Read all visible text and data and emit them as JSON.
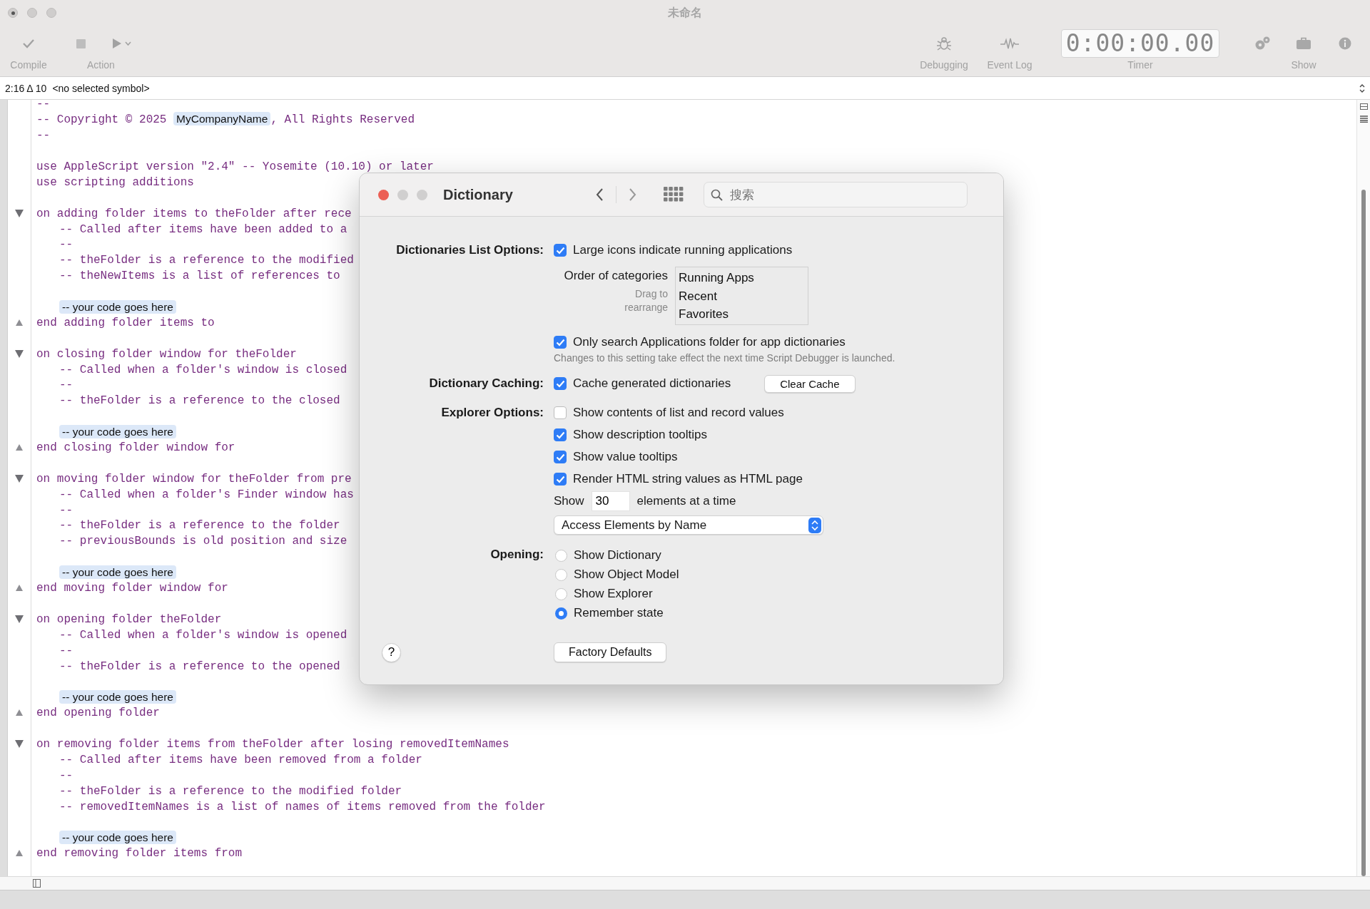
{
  "window": {
    "title": "未命名"
  },
  "toolbar": {
    "left": [
      {
        "kind": "compile",
        "label": "Compile"
      },
      {
        "kind": "action",
        "label": "Action"
      }
    ],
    "right": [
      {
        "kind": "debugging",
        "label": "Debugging"
      },
      {
        "kind": "event_log",
        "label": "Event Log"
      },
      {
        "kind": "timer",
        "label": "Timer",
        "display": "0:00:00.00"
      },
      {
        "kind": "gears"
      },
      {
        "kind": "show",
        "label": "Show"
      },
      {
        "kind": "info"
      }
    ]
  },
  "symbol_bar": {
    "position": "2:16 Δ 10",
    "symbol": "<no selected symbol>"
  },
  "code": [
    {
      "text": "--"
    },
    {
      "parts": [
        {
          "text": "-- Copyright © 2025 ",
          "kind": "code"
        },
        {
          "text": "MyCompanyName",
          "kind": "placeholder"
        },
        {
          "text": ", All Rights Reserved",
          "kind": "code"
        }
      ]
    },
    {
      "text": "--"
    },
    {
      "text": "use AppleScript version \"2.4\" -- Yosemite (10.10) or later",
      "space_before": true
    },
    {
      "text": "use scripting additions"
    },
    {
      "text": "on adding folder items to theFolder after rece",
      "kind": "block_start",
      "space_before": true,
      "children": [
        {
          "text": "-- Called after items have been added to a"
        },
        {
          "text": "--"
        },
        {
          "text": "-- theFolder is a reference to the modified"
        },
        {
          "text": "-- theNewItems is a list of references to"
        },
        {
          "text": "-- your code goes here",
          "kind": "placeholder",
          "space_before": true
        }
      ]
    },
    {
      "text": "end adding folder items to",
      "kind": "block_end"
    },
    {
      "text": "on closing folder window for theFolder",
      "kind": "block_start",
      "space_before": true,
      "children": [
        {
          "text": "-- Called when a folder's window is closed"
        },
        {
          "text": "--"
        },
        {
          "text": "-- theFolder is a reference to the closed"
        },
        {
          "text": "-- your code goes here",
          "kind": "placeholder",
          "space_before": true
        }
      ]
    },
    {
      "text": "end closing folder window for",
      "kind": "block_end"
    },
    {
      "text": "on moving folder window for theFolder from pre",
      "kind": "block_start",
      "space_before": true,
      "children": [
        {
          "text": "-- Called when a folder's Finder window has"
        },
        {
          "text": "--"
        },
        {
          "text": "-- theFolder is a reference to the folder"
        },
        {
          "text": "-- previousBounds is old position and size"
        },
        {
          "text": "-- your code goes here",
          "kind": "placeholder",
          "space_before": true
        }
      ]
    },
    {
      "text": "end moving folder window for",
      "kind": "block_end"
    },
    {
      "text": "on opening folder theFolder",
      "kind": "block_start",
      "space_before": true,
      "children": [
        {
          "text": "-- Called when a folder's window is opened"
        },
        {
          "text": "--"
        },
        {
          "text": "-- theFolder is a reference to the opened"
        },
        {
          "text": "-- your code goes here",
          "kind": "placeholder",
          "space_before": true
        }
      ]
    },
    {
      "text": "end opening folder",
      "kind": "block_end"
    },
    {
      "text": "on removing folder items from theFolder after losing removedItemNames",
      "kind": "block_start",
      "space_before": true,
      "children": [
        {
          "text": "-- Called after items have been removed from a folder"
        },
        {
          "text": "--"
        },
        {
          "text": "-- theFolder is a reference to the modified folder"
        },
        {
          "text": "-- removedItemNames is a list of names of items removed from the folder"
        },
        {
          "text": "-- your code goes here",
          "kind": "placeholder",
          "space_before": true
        }
      ]
    },
    {
      "text": "end removing folder items from",
      "kind": "block_end"
    }
  ],
  "dialog": {
    "title": "Dictionary",
    "search": {
      "placeholder": "搜索"
    },
    "sections": [
      {
        "label": "Dictionaries List Options:",
        "items": [
          {
            "kind": "checkbox",
            "label": "Large icons indicate running applications",
            "checked": true
          },
          {
            "kind": "order_list",
            "label": "Order of categories",
            "hint": "Drag to rearrange",
            "entries": [
              "Running Apps",
              "Recent",
              "Favorites"
            ]
          },
          {
            "kind": "checkbox",
            "label": "Only search Applications folder for app dictionaries",
            "checked": true
          },
          {
            "kind": "note",
            "text": "Changes to this setting take effect the next time Script Debugger is launched."
          }
        ]
      },
      {
        "label": "Dictionary Caching:",
        "items": [
          {
            "kind": "checkbox",
            "label": "Cache generated dictionaries",
            "checked": true,
            "button": "Clear Cache"
          }
        ]
      },
      {
        "label": "Explorer Options:",
        "items": [
          {
            "kind": "checkbox",
            "label": "Show contents of list and record values",
            "checked": false
          },
          {
            "kind": "checkbox",
            "label": "Show description tooltips",
            "checked": true
          },
          {
            "kind": "checkbox",
            "label": "Show value tooltips",
            "checked": true
          },
          {
            "kind": "checkbox",
            "label": "Render HTML string values as HTML page",
            "checked": true
          },
          {
            "kind": "count",
            "before": "Show",
            "value": "30",
            "after": "elements at a time"
          },
          {
            "kind": "popup",
            "value": "Access Elements by Name"
          }
        ]
      },
      {
        "label": "Opening:",
        "items": [
          {
            "kind": "radio",
            "label": "Show Dictionary",
            "selected": false
          },
          {
            "kind": "radio",
            "label": "Show Object Model",
            "selected": false
          },
          {
            "kind": "radio",
            "label": "Show Explorer",
            "selected": false
          },
          {
            "kind": "radio",
            "label": "Remember state",
            "selected": true
          }
        ]
      }
    ],
    "help_button": "?",
    "footer_button": "Factory Defaults"
  }
}
